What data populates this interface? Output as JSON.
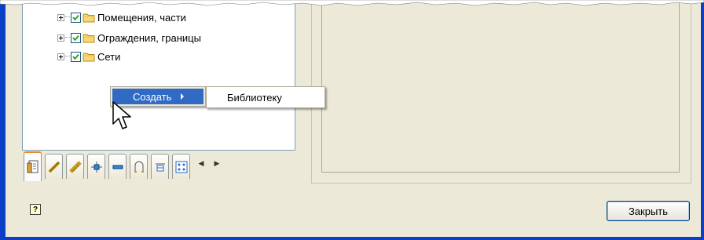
{
  "tree": {
    "nodes": [
      {
        "label": "Помещения, части",
        "checked": true
      },
      {
        "label": "Ограждения, границы",
        "checked": true
      },
      {
        "label": "Сети",
        "checked": true
      }
    ]
  },
  "context_menu": {
    "create_label": "Создать",
    "submenu_item_label": "Библиотеку"
  },
  "tabs": [
    {
      "icon": "document-icon",
      "active": true
    },
    {
      "icon": "ruler-icon"
    },
    {
      "icon": "wall-icon"
    },
    {
      "icon": "column-icon"
    },
    {
      "icon": "beam-icon"
    },
    {
      "icon": "door-icon"
    },
    {
      "icon": "window-icon"
    },
    {
      "icon": "grid-icon"
    }
  ],
  "tab_scroll": {
    "left": "◀",
    "right": "▶"
  },
  "footer": {
    "help_glyph": "?",
    "close_label": "Закрыть"
  },
  "colors": {
    "frame_blue": "#0b3fc6",
    "dialog_bg": "#ece9d8",
    "menu_highlight": "#316ac5",
    "active_tab": "#e68b2c"
  }
}
